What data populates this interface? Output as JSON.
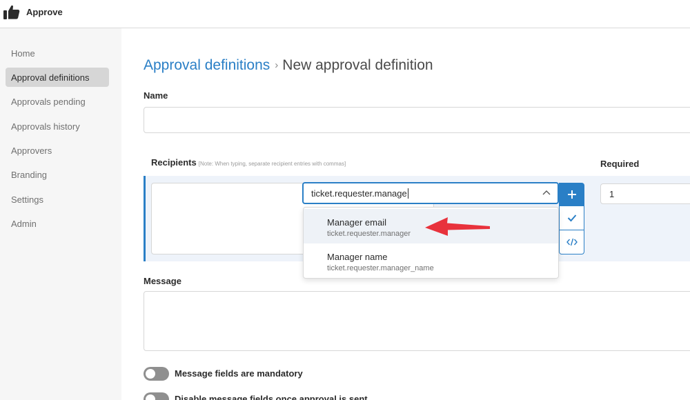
{
  "app": {
    "title": "Approve",
    "logo_icon": "thumbs-up-icon"
  },
  "sidebar": {
    "items": [
      {
        "label": "Home",
        "active": false
      },
      {
        "label": "Approval definitions",
        "active": true
      },
      {
        "label": "Approvals pending",
        "active": false
      },
      {
        "label": "Approvals history",
        "active": false
      },
      {
        "label": "Approvers",
        "active": false
      },
      {
        "label": "Branding",
        "active": false
      },
      {
        "label": "Settings",
        "active": false
      },
      {
        "label": "Admin",
        "active": false
      }
    ]
  },
  "breadcrumb": {
    "parent": "Approval definitions",
    "separator": "›",
    "current": "New approval definition"
  },
  "form": {
    "name_label": "Name",
    "name_value": "",
    "recipients_label": "Recipients",
    "recipients_note": "[Note: When typing, separate recipient entries with commas]",
    "recipients_search_value": "ticket.requester.manage",
    "required_label": "Required",
    "required_value": "1",
    "message_label": "Message",
    "message_value": "",
    "toggles": [
      {
        "label": "Message fields are mandatory",
        "on": false
      },
      {
        "label": "Disable message fields once approval is sent",
        "on": false
      }
    ]
  },
  "dropdown": {
    "options": [
      {
        "title": "Manager email",
        "subtitle": "ticket.requester.manager",
        "highlighted": true
      },
      {
        "title": "Manager name",
        "subtitle": "ticket.requester.manager_name",
        "highlighted": false
      }
    ]
  },
  "buttons": {
    "add_icon": "plus-icon",
    "confirm_icon": "checkmark-icon",
    "code_icon": "code-icon"
  },
  "colors": {
    "accent": "#2a7fc6",
    "sidebar_bg": "#f6f6f6",
    "sidebar_active": "#d6d6d6",
    "recipients_band": "#eef3fa",
    "annotation_arrow": "#e8323c"
  }
}
